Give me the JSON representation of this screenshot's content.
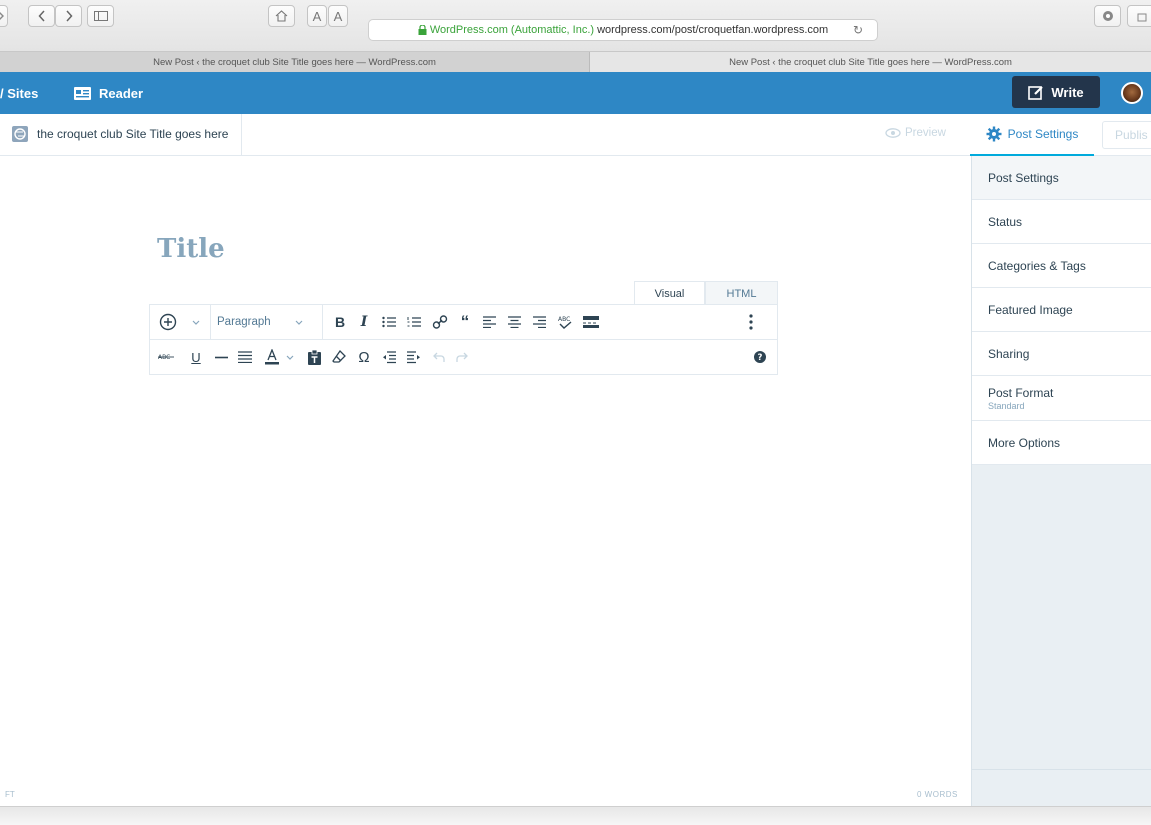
{
  "browser": {
    "url_secure_label": "WordPress.com (Automattic, Inc.)",
    "url_path": "wordpress.com/post/croquetfan.wordpress.com",
    "reader_font_small": "A",
    "reader_font_large": "A",
    "tabs": [
      {
        "label": "New Post ‹ the croquet club Site Title goes here — WordPress.com"
      },
      {
        "label": "New Post ‹ the croquet club Site Title goes here — WordPress.com"
      }
    ]
  },
  "masterbar": {
    "my_sites_label": "/ Sites",
    "reader_label": "Reader",
    "write_label": "Write"
  },
  "editor_header": {
    "site_name": "the croquet club Site Title goes here",
    "preview_label": "Preview",
    "post_settings_label": "Post Settings",
    "publish_label": "Publis"
  },
  "editor": {
    "title_placeholder": "Title",
    "mode_visual": "Visual",
    "mode_html": "HTML",
    "paragraph_label": "Paragraph",
    "word_count": "0 WORDS",
    "footer_status": "FT"
  },
  "sidebar": {
    "items": [
      {
        "label": "Post Settings"
      },
      {
        "label": "Status"
      },
      {
        "label": "Categories & Tags"
      },
      {
        "label": "Featured Image"
      },
      {
        "label": "Sharing"
      },
      {
        "label": "Post Format",
        "sub": "Standard"
      },
      {
        "label": "More Options"
      }
    ]
  },
  "colors": {
    "masterbar": "#2e87c5",
    "write_button": "#23354b",
    "accent": "#00aadc",
    "title_placeholder": "#87a6bc"
  }
}
